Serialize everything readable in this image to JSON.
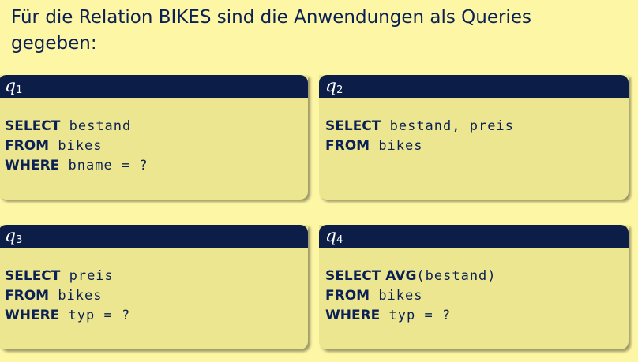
{
  "heading": {
    "line1": "Für die Relation BIKES sind die Anwendungen als Queries",
    "line2": "gegeben:"
  },
  "queries": [
    {
      "title": "q",
      "subscript": "1",
      "lines": [
        {
          "kw": "SELECT",
          "rest": " bestand"
        },
        {
          "kw": "FROM",
          "rest": " bikes"
        },
        {
          "kw": "WHERE",
          "rest": " bname = ?"
        }
      ]
    },
    {
      "title": "q",
      "subscript": "2",
      "lines": [
        {
          "kw": "SELECT",
          "rest": " bestand, preis"
        },
        {
          "kw": "FROM",
          "rest": " bikes"
        }
      ]
    },
    {
      "title": "q",
      "subscript": "3",
      "lines": [
        {
          "kw": "SELECT",
          "rest": " preis"
        },
        {
          "kw": "FROM",
          "rest": " bikes"
        },
        {
          "kw": "WHERE",
          "rest": " typ = ?"
        }
      ]
    },
    {
      "title": "q",
      "subscript": "4",
      "lines": [
        {
          "kw": "SELECT AVG",
          "rest": "(bestand)"
        },
        {
          "kw": "FROM",
          "rest": " bikes"
        },
        {
          "kw": "WHERE",
          "rest": " typ = ?"
        }
      ]
    }
  ]
}
